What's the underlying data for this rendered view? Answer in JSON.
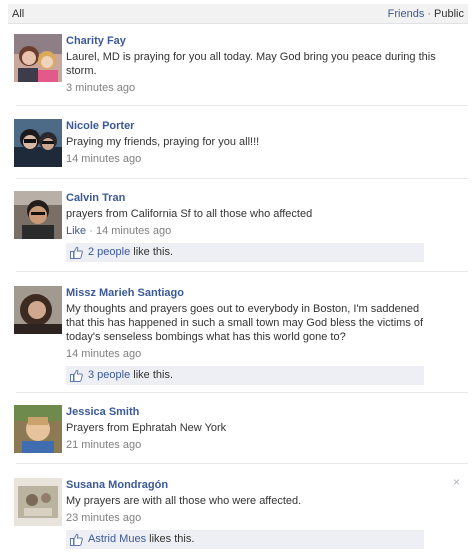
{
  "header": {
    "all_label": "All",
    "friends_label": "Friends",
    "separator": "·",
    "public_label": "Public"
  },
  "comments": [
    {
      "name": "Charity Fay",
      "text": "Laurel, MD is praying for you all today. May God bring you peace during this storm.",
      "time": "3 minutes ago",
      "avatar_icon": "profile-photo"
    },
    {
      "name": "Nicole Porter",
      "text": "Praying my friends, praying for you all!!!",
      "time": "14 minutes ago",
      "avatar_icon": "profile-photo"
    },
    {
      "name": "Calvin Tran",
      "text": "prayers from California Sf to all those who affected",
      "like_label": "Like",
      "meta_sep": " · ",
      "time": "14 minutes ago",
      "likes_count": "2 people",
      "likes_suffix": " like this.",
      "avatar_icon": "profile-photo"
    },
    {
      "name": "Missz Marieh Santiago",
      "text": "My thoughts and prayers goes out to everybody in Boston, I'm saddened that this has happened in such a small town may God bless the victims of today's senseless bombings what has this world gone to?",
      "time": "14 minutes ago",
      "likes_count": "3 people",
      "likes_suffix": " like this.",
      "avatar_icon": "profile-photo"
    },
    {
      "name": "Jessica Smith",
      "text": "Prayers from Ephratah New York",
      "time": "21 minutes ago",
      "avatar_icon": "profile-photo"
    },
    {
      "name": "Susana Mondragón",
      "text": "My prayers are with all those who were affected.",
      "time": "23 minutes ago",
      "likes_count": "Astrid Mues",
      "likes_suffix": " likes this.",
      "close_glyph": "×",
      "avatar_icon": "profile-photo"
    }
  ],
  "colors": {
    "link": "#3b5998",
    "meta": "#808080",
    "likes_bg": "#edeff4",
    "header_bg": "#f2f2f2"
  }
}
